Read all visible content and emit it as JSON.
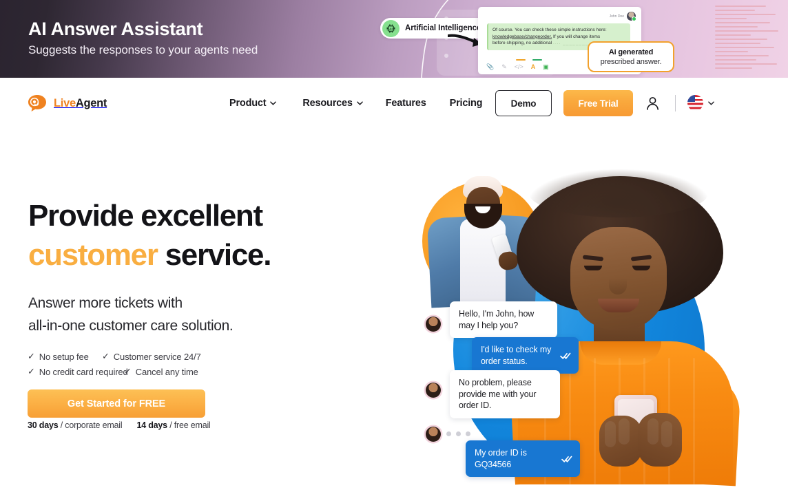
{
  "promo": {
    "title": "AI Answer Assistant",
    "subtitle": "Suggests the responses to your agents need",
    "ai_badge": "Artificial Intelligence",
    "chat_mock": {
      "author": "John Doe",
      "line1": "Of course. You can check these simple instructions here:",
      "line2_link": "knowledgebase/changeorder.",
      "line2_rest": "If you will change items",
      "line3": "before shipping, no additional",
      "line3_ellipsis": "....  ________  ______",
      "toolbar_icons": [
        "paperclip-icon",
        "pencil-icon",
        "code-icon",
        "text-format-icon",
        "ai-icon"
      ]
    },
    "tooltip": {
      "title": "Ai generated",
      "subtitle": "prescribed answer."
    },
    "accent_orange": "#f2a12c",
    "chip_green": "#86e08f"
  },
  "nav": {
    "logo": {
      "live": "Live",
      "agent": "Agent",
      "icon": "at-speech-bubble-icon"
    },
    "links": [
      {
        "label": "Product",
        "has_dropdown": true
      },
      {
        "label": "Resources",
        "has_dropdown": true
      },
      {
        "label": "Features",
        "has_dropdown": false
      },
      {
        "label": "Pricing",
        "has_dropdown": false
      }
    ],
    "demo_button": "Demo",
    "free_trial_button": "Free Trial",
    "account_icon": "user-icon",
    "language_flag": "us-flag-icon",
    "language_chevron": "chevron-down-icon"
  },
  "hero": {
    "heading_line1": "Provide excellent",
    "heading_accent": "customer",
    "heading_line2_rest": " service.",
    "lede_line1": "Answer more tickets with",
    "lede_line2": "all-in-one customer care solution.",
    "perks": [
      [
        "No setup fee",
        "Customer service 24/7"
      ],
      [
        "No credit card required",
        "Cancel any time"
      ]
    ],
    "tick": "✓",
    "cta_label": "Get Started for FREE",
    "trial_note": {
      "days_a": "30 days",
      "text_a": "/ corporate email",
      "days_b": "14 days",
      "text_b": "/ free email"
    },
    "accent_color": "#f9ae41",
    "cta_color": "#fbae43"
  },
  "chat": {
    "messages": [
      {
        "from": "agent",
        "text": "Hello, I'm John, how may I help you?",
        "read": false
      },
      {
        "from": "customer",
        "text": "I'd like to check my order status.",
        "read": true
      },
      {
        "from": "agent",
        "text": "No problem, please provide me with your order ID.",
        "read": false
      },
      {
        "from": "customer",
        "text": "My order ID is GQ34566",
        "read": true
      }
    ],
    "typing_indicator": true,
    "avatar_name": "agent-avatar"
  }
}
